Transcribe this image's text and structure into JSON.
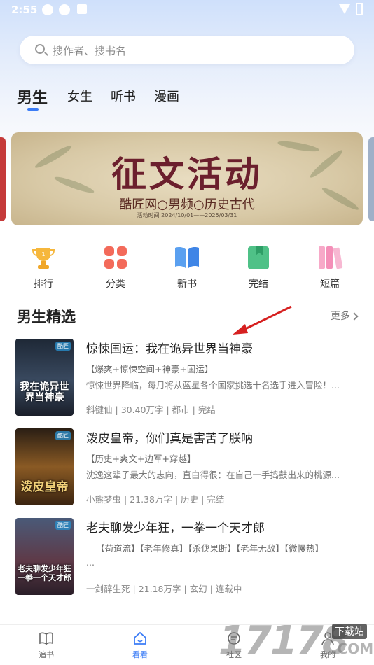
{
  "status_bar": {
    "time": "2:55"
  },
  "search": {
    "placeholder": "搜作者、搜书名"
  },
  "tabs": [
    {
      "label": "男生",
      "active": true
    },
    {
      "label": "女生",
      "active": false
    },
    {
      "label": "听书",
      "active": false
    },
    {
      "label": "漫画",
      "active": false
    }
  ],
  "banner": {
    "title": "征文活动",
    "subtitle": "酷匠网○男频○历史古代",
    "date": "活动时间  2024/10/01——2025/03/31"
  },
  "quick_nav": [
    {
      "label": "排行",
      "icon": "trophy-icon"
    },
    {
      "label": "分类",
      "icon": "category-grid-icon"
    },
    {
      "label": "新书",
      "icon": "open-book-icon"
    },
    {
      "label": "完结",
      "icon": "bookmark-book-icon"
    },
    {
      "label": "短篇",
      "icon": "short-books-icon"
    }
  ],
  "section": {
    "title": "男生精选",
    "more": "更多"
  },
  "books": [
    {
      "title": "惊悚国运：我在诡异世界当神豪",
      "tags": "【爆爽+惊悚空间+神豪+国运】",
      "desc": "惊悚世界降临，每月将从蓝星各个国家挑选十名选手进入冒险！...",
      "author": "斜键仙",
      "words": "30.40万字",
      "category": "都市",
      "status": "完结",
      "cover_text": "我在诡异世界当神豪",
      "cover_badge": "酷匠",
      "cover_color": "#2c3a4e"
    },
    {
      "title": "泼皮皇帝，你们真是害苦了朕呐",
      "tags": "【历史+爽文+边军+穿越】",
      "desc": "沈逸这辈子最大的志向，直白得很：在自己一手捣鼓出来的桃源...",
      "author": "小熊梦虫",
      "words": "21.38万字",
      "category": "历史",
      "status": "完结",
      "cover_text": "泼皮皇帝",
      "cover_badge": "酷匠",
      "cover_color": "#5a3a1e"
    },
    {
      "title": "老夫聊发少年狂，一拳一个天才郎",
      "tags": "【苟道流】【老年修真】【杀伐果断】【老年无敌】【微慢热】",
      "desc": "...",
      "author": "一剑醉生死",
      "words": "21.18万字",
      "category": "玄幻",
      "status": "连载中",
      "cover_text": "老夫聊发少年狂一拳一个天才郎",
      "cover_badge": "酷匠",
      "cover_color": "#3d3045"
    }
  ],
  "bottom_nav": [
    {
      "label": "追书",
      "icon": "book-icon",
      "active": false
    },
    {
      "label": "看看",
      "icon": "home-icon",
      "active": true
    },
    {
      "label": "社区",
      "icon": "community-icon",
      "active": false
    },
    {
      "label": "我的",
      "icon": "profile-icon",
      "active": false
    }
  ],
  "watermark": {
    "number": "17178",
    "tag": "下载站",
    "domain": ".COM"
  },
  "colors": {
    "accent": "#3b7cf6",
    "annotation_arrow": "#d62020"
  }
}
